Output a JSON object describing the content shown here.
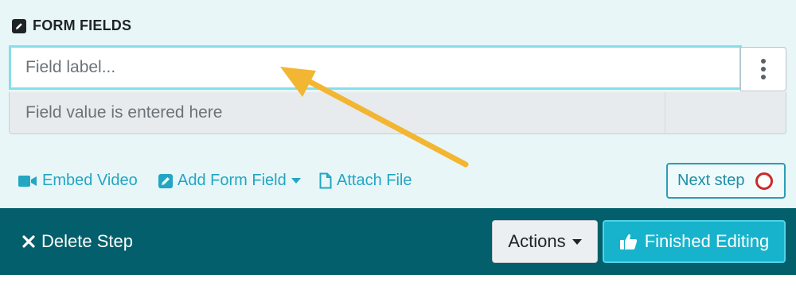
{
  "section": {
    "title": "FORM FIELDS",
    "icon": "pencil-square-icon"
  },
  "field": {
    "label_placeholder": "Field label...",
    "value_placeholder": "Field value is entered here",
    "menu_icon": "kebab-menu-icon"
  },
  "toolbar": {
    "embed_video": "Embed Video",
    "add_form_field": "Add Form Field",
    "attach_file": "Attach File",
    "next_step": "Next step"
  },
  "footer": {
    "delete_step": "Delete Step",
    "actions": "Actions",
    "finished_editing": "Finished Editing"
  },
  "colors": {
    "accent": "#22a6c2",
    "footer_bg": "#025f6b",
    "primary_button": "#17b3cc",
    "annotation_arrow": "#f2b632",
    "status_ring": "#cc2a2a"
  }
}
